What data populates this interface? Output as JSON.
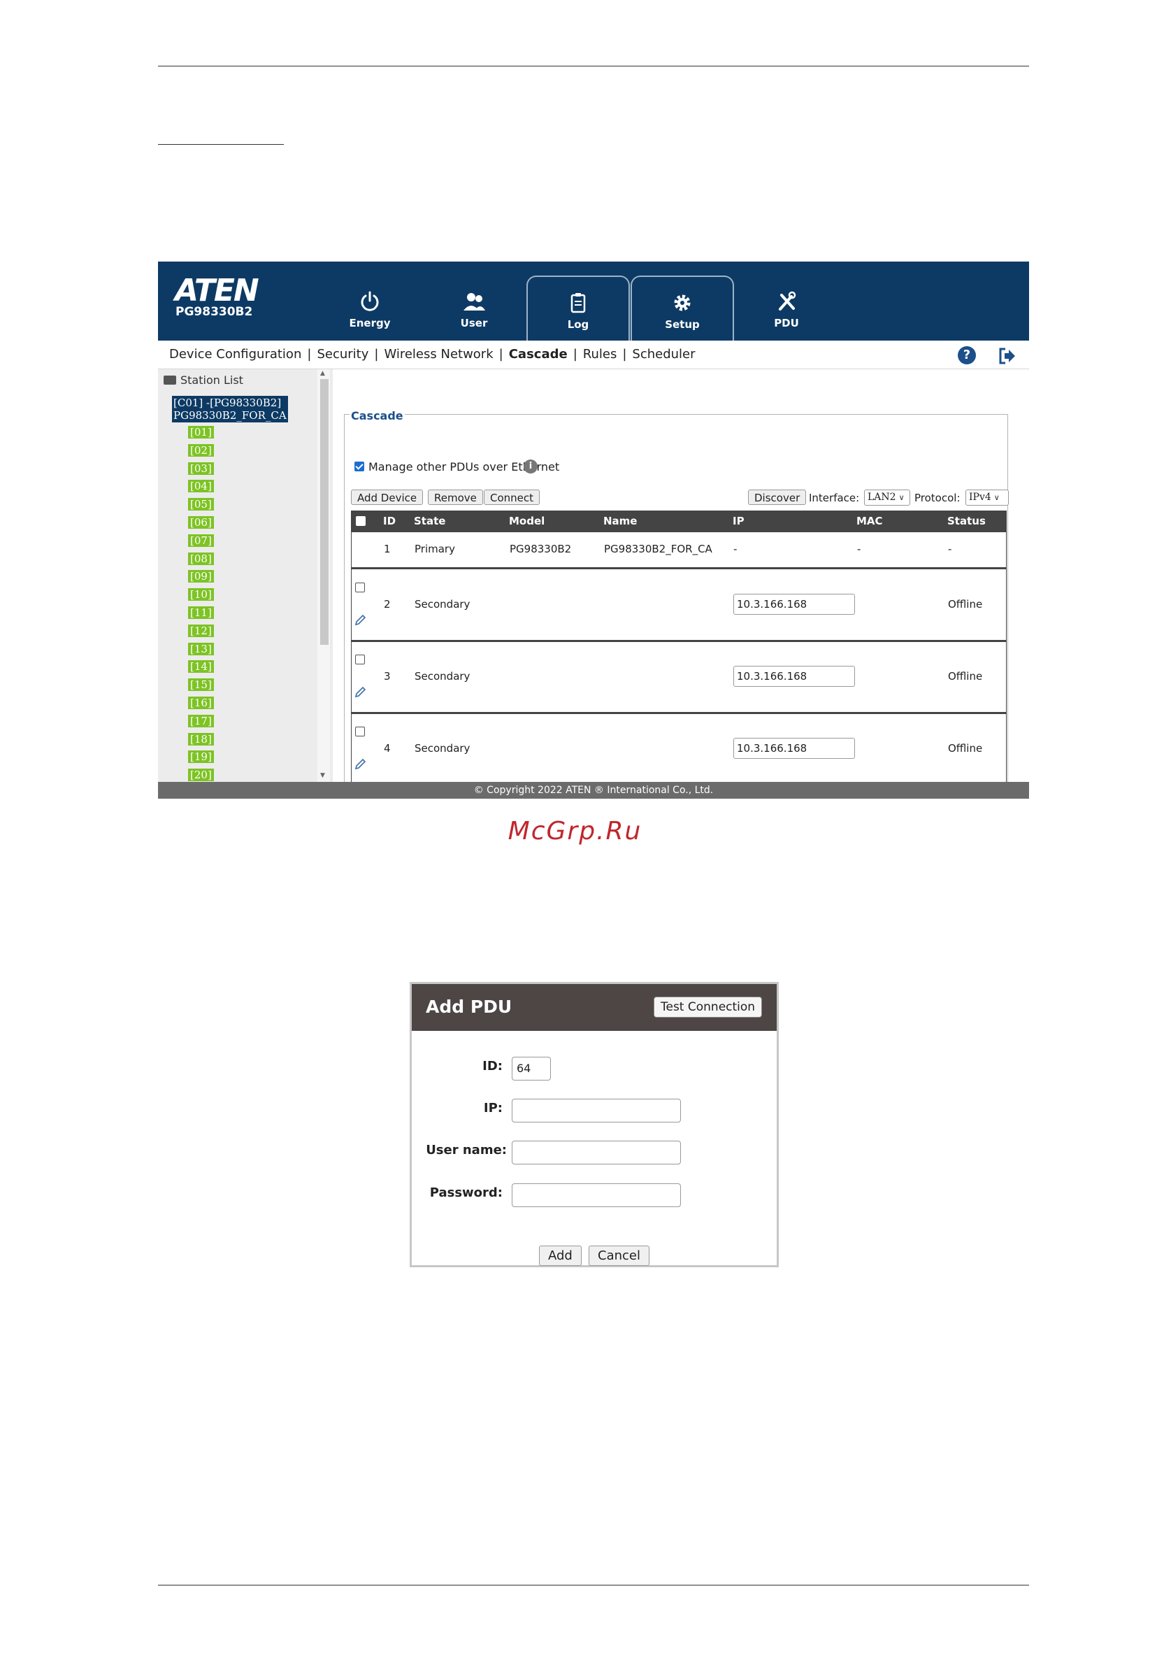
{
  "brand": {
    "logo": "ATEN",
    "model": "PG98330B2"
  },
  "nav_tabs": [
    {
      "label": "Energy",
      "icon": "power-icon"
    },
    {
      "label": "User",
      "icon": "users-icon"
    },
    {
      "label": "Log",
      "icon": "clipboard-icon"
    },
    {
      "label": "Setup",
      "icon": "gear-icon"
    },
    {
      "label": "PDU",
      "icon": "tools-icon"
    }
  ],
  "subnav": {
    "items": [
      "Device Configuration",
      "Security",
      "Wireless Network",
      "Cascade",
      "Rules",
      "Scheduler"
    ],
    "separator": "|",
    "active": "Cascade"
  },
  "sidebar": {
    "title": "Station List",
    "root_line1": "[C01] -[PG98330B2]",
    "root_line2": "PG98330B2_FOR_CA",
    "nodes": [
      "[01]",
      "[02]",
      "[03]",
      "[04]",
      "[05]",
      "[06]",
      "[07]",
      "[08]",
      "[09]",
      "[10]",
      "[11]",
      "[12]",
      "[13]",
      "[14]",
      "[15]",
      "[16]",
      "[17]",
      "[18]",
      "[19]",
      "[20]"
    ]
  },
  "cascade": {
    "legend": "Cascade",
    "manage_label": "Manage other PDUs over Ethernet",
    "manage_checked": true,
    "buttons": {
      "add": "Add Device",
      "remove": "Remove",
      "connect": "Connect",
      "discover": "Discover"
    },
    "interface_label": "Interface:",
    "interface_value": "LAN2",
    "protocol_label": "Protocol:",
    "protocol_value": "IPv4",
    "columns": [
      "ID",
      "State",
      "Model",
      "Name",
      "IP",
      "MAC",
      "Status"
    ],
    "rows": [
      {
        "id": "1",
        "state": "Primary",
        "model": "PG98330B2",
        "name": "PG98330B2_FOR_CA",
        "ip": "-",
        "mac": "-",
        "status": "-"
      },
      {
        "id": "2",
        "state": "Secondary",
        "model": "",
        "name": "",
        "ip": "10.3.166.168",
        "mac": "",
        "status": "Offline"
      },
      {
        "id": "3",
        "state": "Secondary",
        "model": "",
        "name": "",
        "ip": "10.3.166.168",
        "mac": "",
        "status": "Offline"
      },
      {
        "id": "4",
        "state": "Secondary",
        "model": "",
        "name": "",
        "ip": "10.3.166.168",
        "mac": "",
        "status": "Offline"
      }
    ]
  },
  "footer": "© Copyright 2022 ATEN ® International Co., Ltd.",
  "watermark": "McGrp.Ru",
  "dialog": {
    "title": "Add PDU",
    "test_button": "Test Connection",
    "fields": {
      "id_label": "ID:",
      "id_value": "64",
      "ip_label": "IP:",
      "ip_value": "",
      "user_label": "User name:",
      "user_value": "",
      "password_label": "Password:",
      "password_value": ""
    },
    "add_button": "Add",
    "cancel_button": "Cancel"
  },
  "colors": {
    "header": "#0d3a64",
    "node_green": "#7dc324",
    "accent_blue": "#1d4f8a",
    "dialog_header": "#4d4645"
  }
}
